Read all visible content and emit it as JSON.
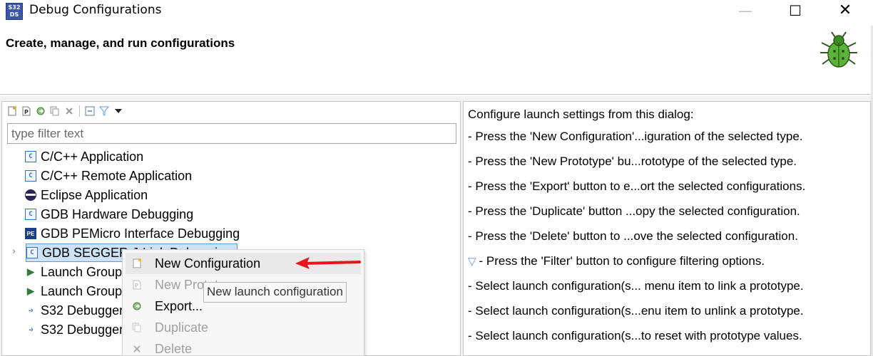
{
  "window": {
    "title": "Debug Configurations",
    "app_icon_text": "S32\nDS",
    "minimize_glyph": "—",
    "maximize_glyph": "☐",
    "close_glyph": "✕"
  },
  "banner": {
    "title": "Create, manage, and run configurations",
    "icon": "bug-icon"
  },
  "toolbar": {
    "buttons": [
      "new-configuration-icon",
      "new-prototype-icon",
      "export-icon",
      "duplicate-icon",
      "delete-icon",
      "collapse-all-icon",
      "filter-icon",
      "view-menu-icon"
    ]
  },
  "filter": {
    "placeholder": "type filter text",
    "value": ""
  },
  "tree": {
    "items": [
      {
        "label": "C/C++ Application",
        "icon": "c-app-icon"
      },
      {
        "label": "C/C++ Remote Application",
        "icon": "c-app-icon"
      },
      {
        "label": "Eclipse Application",
        "icon": "eclipse-icon"
      },
      {
        "label": "GDB Hardware Debugging",
        "icon": "c-app-icon"
      },
      {
        "label": "GDB PEMicro Interface Debugging",
        "icon": "pemicro-icon"
      },
      {
        "label": "GDB SEGGER J-Link Debugging",
        "icon": "c-app-icon",
        "selected": true,
        "expandable": true
      },
      {
        "label": "Launch Group",
        "icon": "launch-group-icon"
      },
      {
        "label": "Launch Group",
        "icon": "launch-group-icon"
      },
      {
        "label": "S32 Debugger",
        "icon": "s32-debugger-icon"
      },
      {
        "label": "S32 Debugger",
        "icon": "s32-debugger-icon"
      }
    ],
    "selected_visible_label": "GDB SEGGER J-Link Debugging"
  },
  "context_menu": {
    "items": [
      {
        "label": "New Configuration",
        "enabled": true,
        "icon": "new-configuration-icon"
      },
      {
        "label": "New Prototype",
        "enabled": false,
        "icon": "new-prototype-icon"
      },
      {
        "label": "Export...",
        "enabled": true,
        "icon": "export-icon"
      },
      {
        "label": "Duplicate",
        "enabled": false,
        "icon": "duplicate-icon"
      },
      {
        "label": "Delete",
        "enabled": false,
        "icon": "delete-icon"
      }
    ]
  },
  "tooltip": {
    "text": "New launch configuration"
  },
  "help": {
    "heading": "Configure launch settings from this dialog:",
    "lines": [
      "- Press the 'New Configuration'...iguration of the selected type.",
      "- Press the 'New Prototype' bu...rototype of the selected type.",
      "- Press the 'Export' button to e...ort the selected configurations.",
      "- Press the 'Duplicate' button ...opy the selected configuration.",
      "- Press the 'Delete' button to ...ove the selected configuration.",
      "- Press the 'Filter' button to configure filtering options.",
      "- Select launch configuration(s... menu item to link a prototype.",
      "- Select launch configuration(s...enu item to unlink a prototype.",
      "- Select launch configuration(s...to reset with prototype values."
    ]
  },
  "colors": {
    "selection_bg": "#cce3f7",
    "selection_border": "#5c9bd6",
    "annotation_arrow": "#e8141c"
  }
}
